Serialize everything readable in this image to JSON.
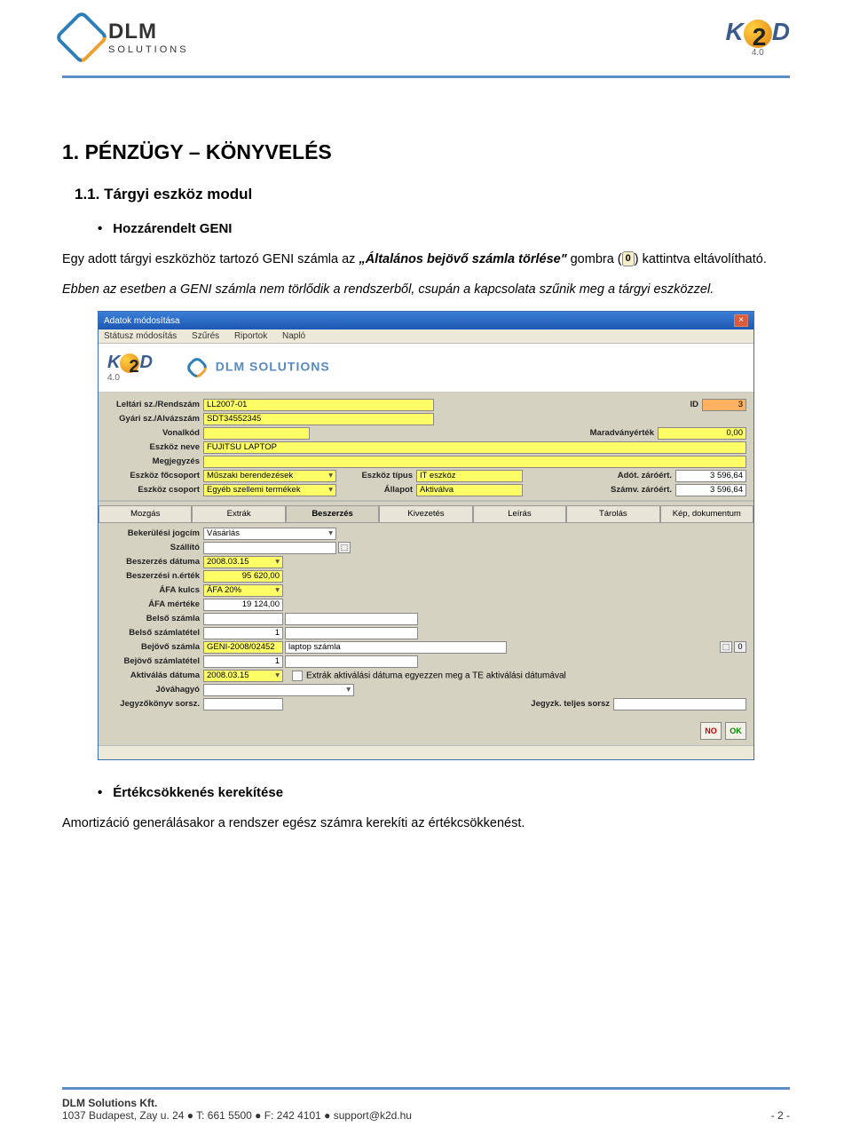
{
  "header": {
    "logo_left_name": "DLM",
    "logo_left_sub": "SOLUTIONS",
    "logo_right_name": "K D",
    "logo_right_sub": "4.0"
  },
  "doc": {
    "h1": "1.   PÉNZÜGY – KÖNYVELÉS",
    "h2": "1.1. Tárgyi eszköz modul",
    "bullet1": "Hozzárendelt GENI",
    "para1_a": "Egy adott tárgyi eszközhöz tartozó GENI számla az ",
    "para1_bold": "„Általános bejövő számla törlése\"",
    "para1_b": " gombra (",
    "para1_c": ") kattintva eltávolítható.",
    "para2": "Ebben az esetben a GENI számla nem törlődik a rendszerből, csupán a kapcsolata szűnik meg a tárgyi eszközzel.",
    "bullet2": "Értékcsökkenés kerekítése",
    "para3": "Amortizáció generálásakor a rendszer egész számra kerekíti az értékcsökkenést.",
    "zero_icon": "0"
  },
  "window": {
    "title": "Adatok módosítása",
    "menu": [
      "Státusz módosítás",
      "Szűrés",
      "Riportok",
      "Napló"
    ],
    "brand_k2d": "K D",
    "brand_k2d_sub": "4.0",
    "brand_dlm": "DLM SOLUTIONS",
    "fields": {
      "leltari_lbl": "Leltári sz./Rendszám",
      "leltari_val": "LL2007-01",
      "id_lbl": "ID",
      "id_val": "3",
      "gyari_lbl": "Gyári sz./Alvázszám",
      "gyari_val": "SDT34552345",
      "vonalkod_lbl": "Vonalkód",
      "maradvany_lbl": "Maradványérték",
      "maradvany_val": "0,00",
      "eszkoznev_lbl": "Eszköz neve",
      "eszkoznev_val": "FUJITSU LAPTOP",
      "megj_lbl": "Megjegyzés",
      "focs_lbl": "Eszköz főcsoport",
      "focs_val": "Műszaki berendezések",
      "tipus_lbl": "Eszköz típus",
      "tipus_val": "IT eszköz",
      "adot_lbl": "Adót. záróért.",
      "adot_val": "3 596,64",
      "cs_lbl": "Eszköz csoport",
      "cs_val": "Egyéb szellemi termékek",
      "allapot_lbl": "Állapot",
      "allapot_val": "Aktiválva",
      "szamv_lbl": "Számv. záróért.",
      "szamv_val": "3 596,64"
    },
    "tabs": [
      "Mozgás",
      "Extrák",
      "Beszerzés",
      "Kivezetés",
      "Leírás",
      "Tárolás",
      "Kép, dokumentum"
    ],
    "lower": {
      "jogcim_lbl": "Bekerülési jogcím",
      "jogcim_val": "Vásárlás",
      "szallito_lbl": "Szállító",
      "beszdat_lbl": "Beszerzés dátuma",
      "beszdat_val": "2008.03.15",
      "nert_lbl": "Beszerzési n.érték",
      "nert_val": "95 620,00",
      "afakulcs_lbl": "ÁFA kulcs",
      "afakulcs_val": "ÁFA 20%",
      "afamert_lbl": "ÁFA mértéke",
      "afamert_val": "19 124,00",
      "bszamla_lbl": "Belső számla",
      "btetel_lbl": "Belső számlatétel",
      "btetel_val": "1",
      "bejovo_lbl": "Bejövő számla",
      "bejovo_val": "GENI-2008/02452",
      "bejovo_desc": "laptop számla",
      "bejtetel_lbl": "Bejövő számlatétel",
      "bejtetel_val": "1",
      "aktdat_lbl": "Aktiválás dátuma",
      "aktdat_val": "2008.03.15",
      "chk_lbl": "Extrák aktiválási dátuma egyezzen meg a TE aktiválási dátumával",
      "jovahagyo_lbl": "Jóváhagyó",
      "jegyz_lbl": "Jegyzőkönyv sorsz.",
      "jegyz2_lbl": "Jegyzk. teljes sorsz"
    },
    "buttons": {
      "no": "NO",
      "ok": "OK"
    }
  },
  "footer": {
    "company": "DLM Solutions Kft.",
    "address": "1037 Budapest, Zay u. 24  ●  T: 661 5500  ●  F: 242 4101  ●  support@k2d.hu",
    "page": "- 2 -"
  }
}
